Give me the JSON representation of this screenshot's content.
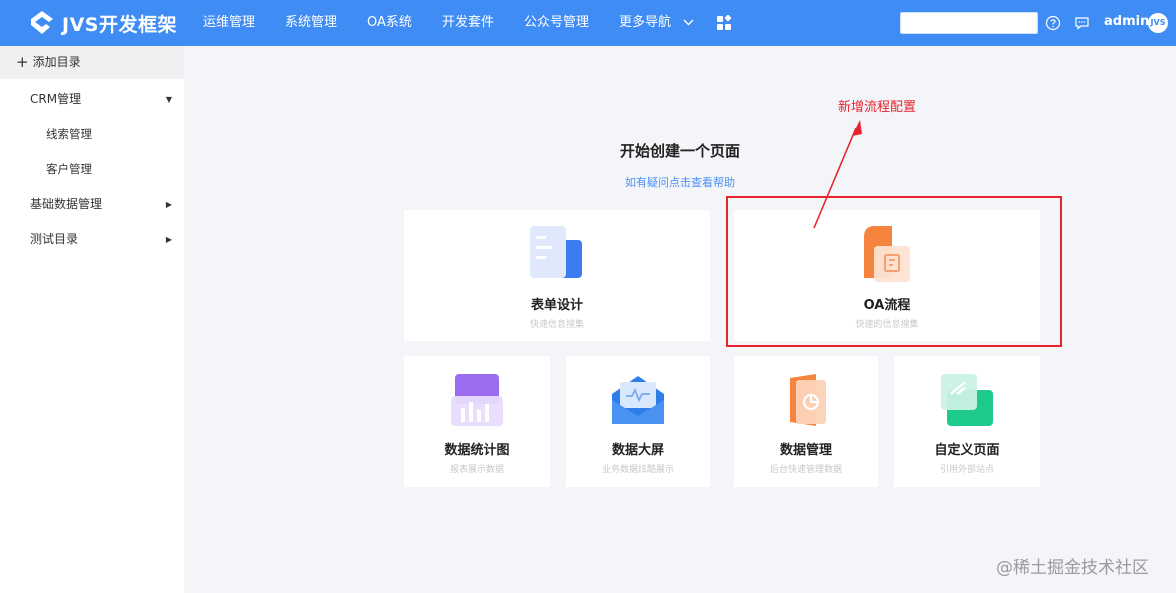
{
  "header": {
    "logo_text": "JVS开发框架",
    "nav": [
      {
        "label": "运维管理"
      },
      {
        "label": "系统管理"
      },
      {
        "label": "OA系统"
      },
      {
        "label": "开发套件"
      },
      {
        "label": "公众号管理"
      },
      {
        "label": "更多导航"
      }
    ],
    "search_value": "",
    "username": "admin",
    "avatar_text": "JVS",
    "icons": [
      "apps-grid-icon",
      "help-circle-icon",
      "message-icon"
    ]
  },
  "sidebar": {
    "add_label": "添加目录",
    "items": [
      {
        "label": "CRM管理",
        "expanded": true
      },
      {
        "label": "线索管理"
      },
      {
        "label": "客户管理"
      },
      {
        "label": "基础数据管理",
        "expanded": false
      },
      {
        "label": "测试目录",
        "expanded": false
      }
    ]
  },
  "main": {
    "title": "开始创建一个页面",
    "help_link": "如有疑问点击查看帮助",
    "cards": [
      {
        "title": "表单设计",
        "desc": "快速信息搜集"
      },
      {
        "title": "OA流程",
        "desc": "快速的信息搜集"
      },
      {
        "title": "数据统计图",
        "desc": "报表展示数据"
      },
      {
        "title": "数据大屏",
        "desc": "业务数据炫酷展示"
      },
      {
        "title": "数据管理",
        "desc": "后台快速管理数据"
      },
      {
        "title": "自定义页面",
        "desc": "引用外部站点"
      }
    ]
  },
  "annotation": {
    "text": "新增流程配置",
    "color": "#e8232d"
  },
  "watermark": "@稀土掘金技术社区",
  "colors": {
    "header_bg": "#3f8cf4",
    "link": "#4a8ff5",
    "highlight": "#e8232d"
  }
}
